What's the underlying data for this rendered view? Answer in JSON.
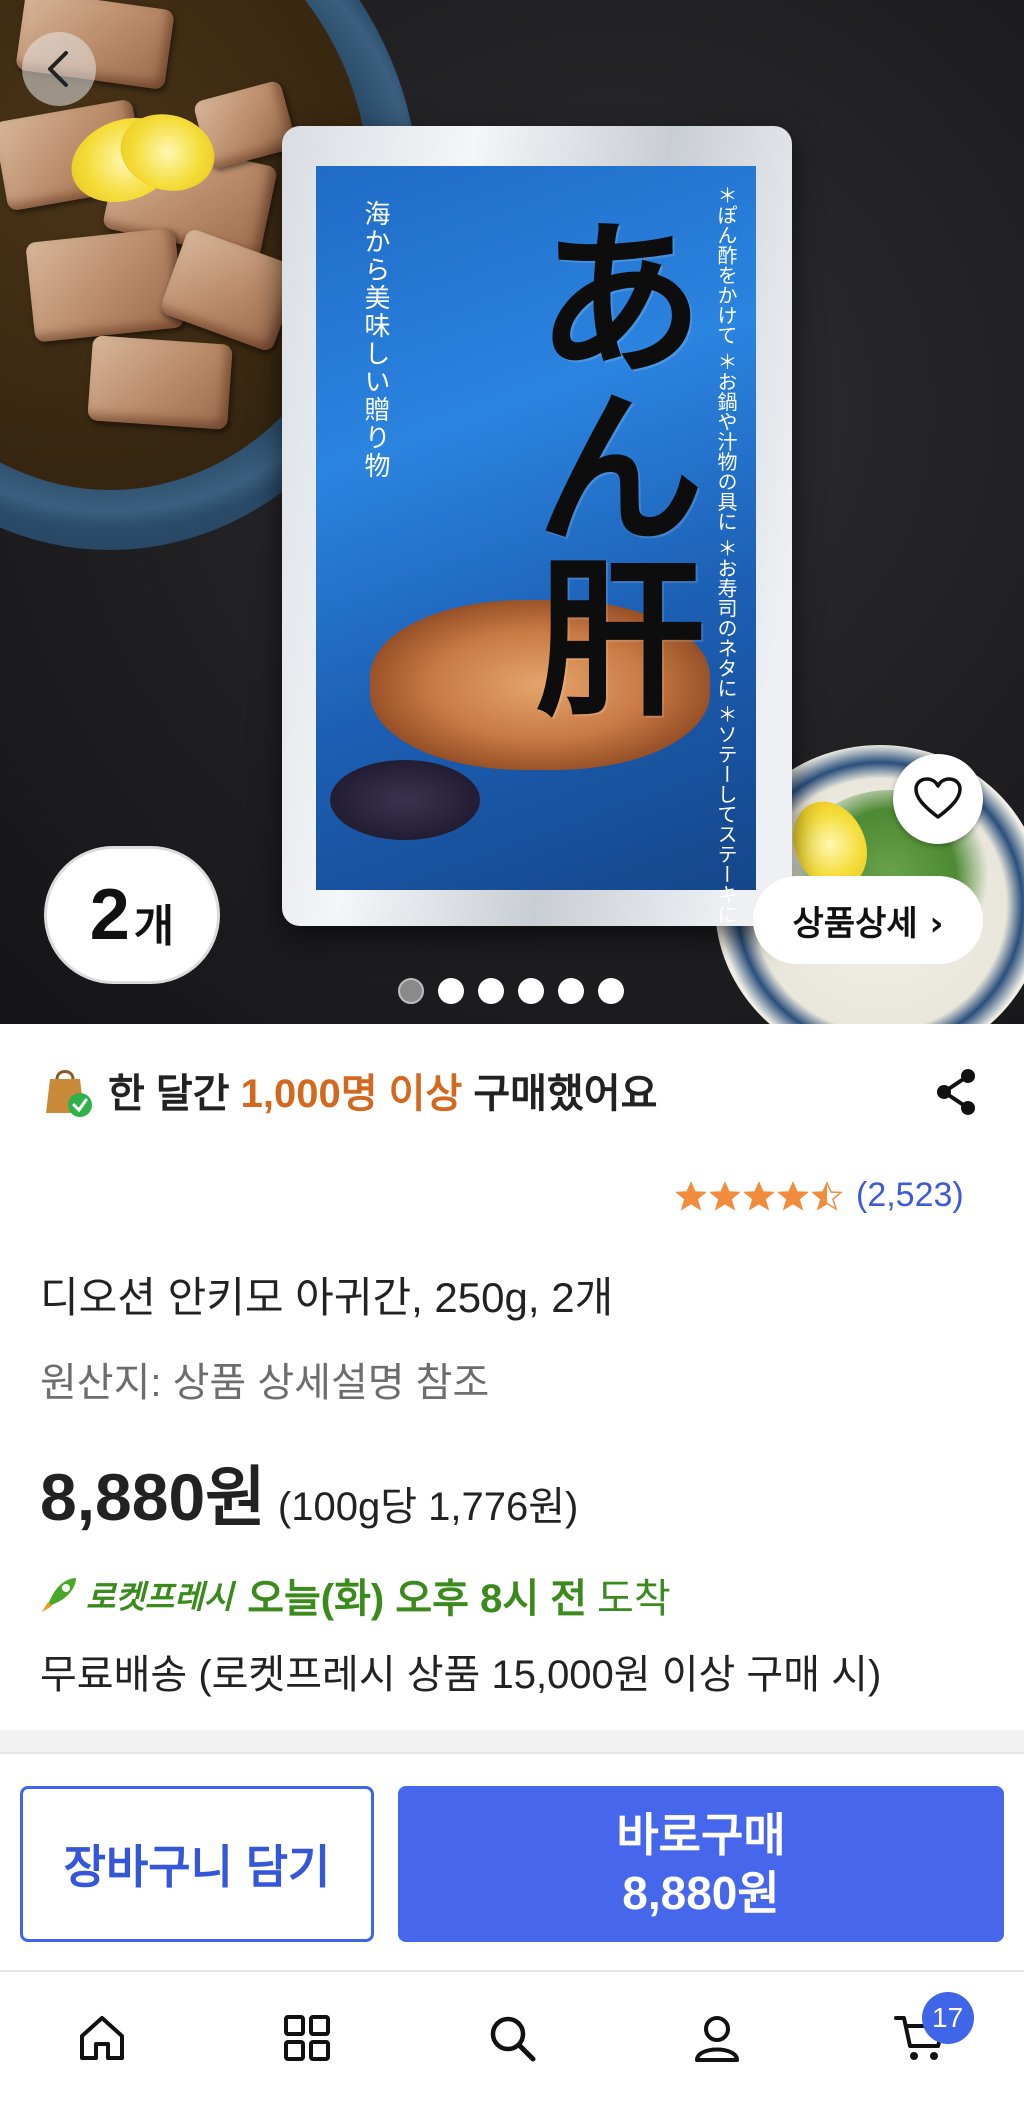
{
  "hero": {
    "package_title": "あん肝",
    "package_side_text": "海から美味しい贈り物",
    "package_bullets": "＊ぽん酢をかけて ＊お鍋や汁物の具に ＊お寿司のネタに ＊ソテーしてステーキに",
    "quantity_number": "2",
    "quantity_unit": "개",
    "detail_button": "상품상세 ›",
    "carousel_total": 6,
    "carousel_active": 1
  },
  "purchase_badge": {
    "prefix": "한 달간 ",
    "highlight": "1,000명 이상",
    "suffix": " 구매했어요"
  },
  "rating": {
    "stars": 4.5,
    "count": "(2,523)"
  },
  "product": {
    "title": "디오션 안키모 아귀간, 250g, 2개",
    "origin": "원산지: 상품 상세설명 참조",
    "price": "8,880원",
    "unit_price": "(100g당 1,776원)"
  },
  "delivery": {
    "badge": "로켓프레시",
    "time": "오늘(화) 오후 8시 전",
    "arrive": "도착",
    "shipping": "무료배송 (로켓프레시 상품 15,000원 이상 구매 시)"
  },
  "actions": {
    "cart_label": "장바구니 담기",
    "buy_label": "바로구매",
    "buy_price": "8,880원"
  },
  "tabbar": {
    "cart_count": "17"
  },
  "colors": {
    "accent": "#4667ec",
    "highlight_orange": "#d2691e",
    "rocket_green": "#3a8a1c",
    "star": "#f08c3b"
  }
}
